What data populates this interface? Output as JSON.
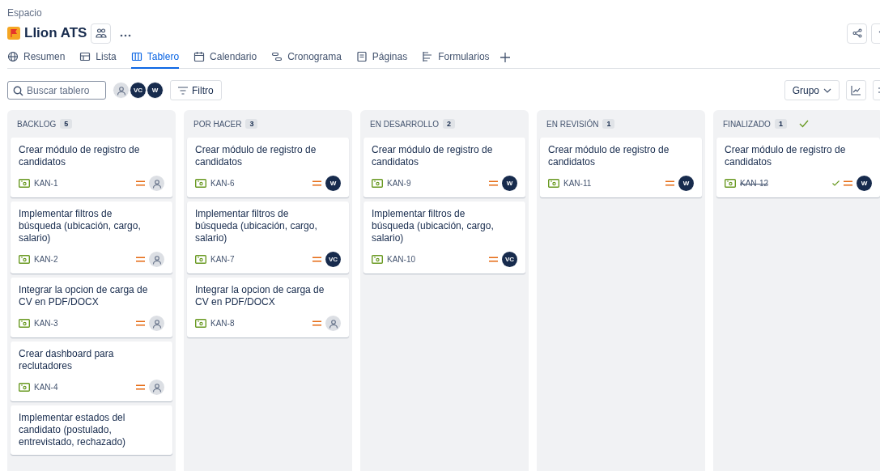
{
  "breadcrumb": "Espacio",
  "project": {
    "title": "Llion ATS"
  },
  "tabs": [
    {
      "label": "Resumen",
      "selected": false
    },
    {
      "label": "Lista",
      "selected": false
    },
    {
      "label": "Tablero",
      "selected": true
    },
    {
      "label": "Calendario",
      "selected": false
    },
    {
      "label": "Cronograma",
      "selected": false
    },
    {
      "label": "Páginas",
      "selected": false
    },
    {
      "label": "Formularios",
      "selected": false
    }
  ],
  "search": {
    "placeholder": "Buscar tablero"
  },
  "avatars": [
    {
      "kind": "empty"
    },
    {
      "kind": "initials",
      "initials": "VC"
    },
    {
      "kind": "initials",
      "initials": "W"
    }
  ],
  "filter_button": "Filtro",
  "group_button": "Grupo",
  "columns": [
    {
      "title": "BACKLOG",
      "count": "5",
      "done": false,
      "cards": [
        {
          "title": "Crear módulo de registro de candidatos",
          "key": "KAN-1"
        },
        {
          "title": "Implementar filtros de búsqueda (ubicación, cargo, salario)",
          "key": "KAN-2"
        },
        {
          "title": "Integrar la opcion de carga de CV en PDF/DOCX",
          "key": "KAN-3"
        },
        {
          "title": "Crear dashboard para reclutadores",
          "key": "KAN-4"
        },
        {
          "title": "Implementar estados del candidato (postulado, entrevistado, rechazado)"
        }
      ]
    },
    {
      "title": "POR HACER",
      "count": "3",
      "done": false,
      "cards": [
        {
          "title": "Crear módulo de registro de candidatos",
          "key": "KAN-6",
          "assignee": "W"
        },
        {
          "title": "Implementar filtros de búsqueda (ubicación, cargo, salario)",
          "key": "KAN-7",
          "assignee": "VC"
        },
        {
          "title": "Integrar la opcion de carga de CV en PDF/DOCX",
          "key": "KAN-8"
        }
      ]
    },
    {
      "title": "EN DESARROLLO",
      "count": "2",
      "done": false,
      "cards": [
        {
          "title": "Crear módulo de registro de candidatos",
          "key": "KAN-9",
          "assignee": "W"
        },
        {
          "title": "Implementar filtros de búsqueda (ubicación, cargo, salario)",
          "key": "KAN-10",
          "assignee": "VC"
        }
      ]
    },
    {
      "title": "EN REVISIÓN",
      "count": "1",
      "done": false,
      "cards": [
        {
          "title": "Crear módulo de registro de candidatos",
          "key": "KAN-11",
          "assignee": "W"
        }
      ]
    },
    {
      "title": "FINALIZADO",
      "count": "1",
      "done": true,
      "cards": [
        {
          "title": "Crear módulo de registro de candidatos",
          "key": "KAN-12",
          "assignee": "W"
        }
      ]
    }
  ]
}
